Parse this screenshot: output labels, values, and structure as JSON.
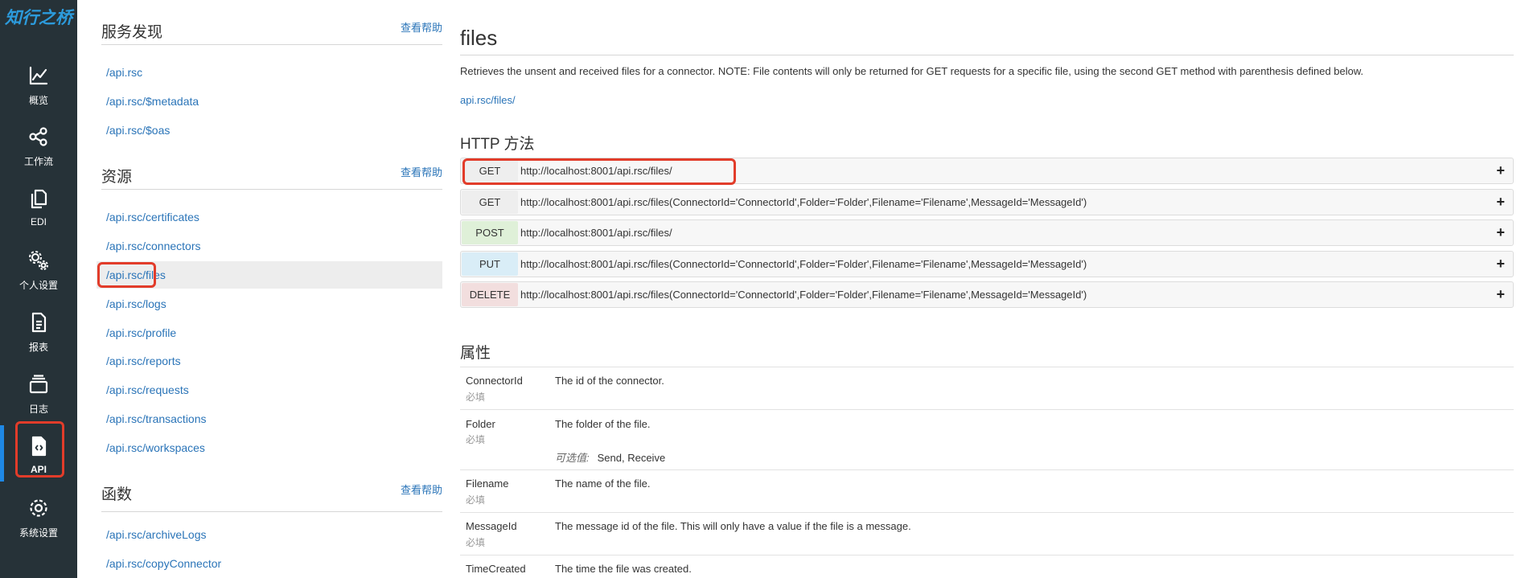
{
  "app": {
    "logo_text": "知行之桥",
    "accent": "#2c9bdc",
    "highlight": "#e23c2a"
  },
  "nav": {
    "items": [
      {
        "label": "概览",
        "icon": "chart-line-icon"
      },
      {
        "label": "工作流",
        "icon": "share-nodes-icon"
      },
      {
        "label": "EDI",
        "icon": "copy-documents-icon"
      },
      {
        "label": "个人设置",
        "icon": "gears-icon"
      },
      {
        "label": "报表",
        "icon": "report-file-icon"
      },
      {
        "label": "日志",
        "icon": "log-stack-icon"
      },
      {
        "label": "API",
        "icon": "api-file-icon"
      },
      {
        "label": "系统设置",
        "icon": "gear-icon"
      }
    ],
    "active": "API"
  },
  "mid": {
    "service_discovery": {
      "title": "服务发现",
      "help": "查看帮助",
      "links": [
        "/api.rsc",
        "/api.rsc/$metadata",
        "/api.rsc/$oas"
      ]
    },
    "resources": {
      "title": "资源",
      "help": "查看帮助",
      "links": [
        "/api.rsc/certificates",
        "/api.rsc/connectors",
        "/api.rsc/files",
        "/api.rsc/logs",
        "/api.rsc/profile",
        "/api.rsc/reports",
        "/api.rsc/requests",
        "/api.rsc/transactions",
        "/api.rsc/workspaces"
      ],
      "selected": "/api.rsc/files"
    },
    "functions": {
      "title": "函数",
      "help": "查看帮助",
      "links": [
        "/api.rsc/archiveLogs",
        "/api.rsc/copyConnector"
      ]
    }
  },
  "main": {
    "title": "files",
    "description": "Retrieves the unsent and received files for a connector. NOTE: File contents will only be returned for GET requests for a specific file, using the second GET method with parenthesis defined below.",
    "path": "api.rsc/files/",
    "methods_title": "HTTP 方法",
    "methods": [
      {
        "method": "GET",
        "url": "http://localhost:8001/api.rsc/files/",
        "color": "#eeeeee"
      },
      {
        "method": "GET",
        "url": "http://localhost:8001/api.rsc/files(ConnectorId='ConnectorId',Folder='Folder',Filename='Filename',MessageId='MessageId')",
        "color": "#eeeeee"
      },
      {
        "method": "POST",
        "url": "http://localhost:8001/api.rsc/files/",
        "color": "#dff0d8"
      },
      {
        "method": "PUT",
        "url": "http://localhost:8001/api.rsc/files(ConnectorId='ConnectorId',Folder='Folder',Filename='Filename',MessageId='MessageId')",
        "color": "#d9edf7"
      },
      {
        "method": "DELETE",
        "url": "http://localhost:8001/api.rsc/files(ConnectorId='ConnectorId',Folder='Folder',Filename='Filename',MessageId='MessageId')",
        "color": "#f2dede"
      }
    ],
    "expand_symbol": "+",
    "properties_title": "属性",
    "properties": [
      {
        "name": "ConnectorId",
        "required": "必填",
        "desc": "The id of the connector."
      },
      {
        "name": "Folder",
        "required": "必填",
        "desc": "The folder of the file.",
        "options_label": "可选值:",
        "options": "Send, Receive"
      },
      {
        "name": "Filename",
        "required": "必填",
        "desc": "The name of the file."
      },
      {
        "name": "MessageId",
        "required": "必填",
        "desc": "The message id of the file. This will only have a value if the file is a message."
      },
      {
        "name": "TimeCreated",
        "required": "",
        "desc": "The time the file was created."
      }
    ]
  }
}
